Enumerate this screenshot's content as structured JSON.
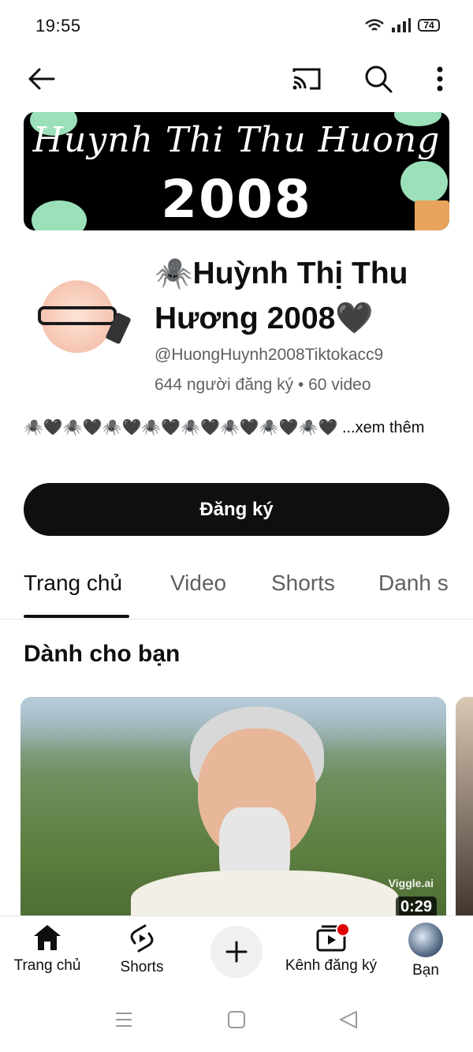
{
  "status_bar": {
    "time": "19:55",
    "battery": "74",
    "icons": [
      "wifi-icon",
      "signal-icon",
      "battery-icon"
    ]
  },
  "top_bar": {
    "icons": [
      "back-arrow-icon",
      "cast-icon",
      "search-icon",
      "more-vert-icon"
    ]
  },
  "banner": {
    "script_text": "Huynh Thi Thu Huong",
    "year": "2008"
  },
  "channel": {
    "name": "🕷️Huỳnh Thị Thu Hương 2008🖤",
    "handle": "@HuongHuynh2008Tiktokacc9",
    "stats": "644 người đăng ký • 60 video",
    "bio": "🕷️🖤🕷️🖤🕷️🖤🕷️🖤🕷️🖤🕷️🖤🕷️🖤🕷️🖤 ...xem thêm",
    "subscribe_label": "Đăng ký"
  },
  "tabs": [
    {
      "label": "Trang chủ",
      "active": true
    },
    {
      "label": "Video",
      "active": false
    },
    {
      "label": "Shorts",
      "active": false
    },
    {
      "label": "Danh s",
      "active": false
    }
  ],
  "section": {
    "title": "Dành cho bạn"
  },
  "video_card": {
    "duration": "0:29",
    "watermark": "Viggle.ai"
  },
  "bottom_nav": {
    "items": [
      {
        "label": "Trang chủ",
        "icon": "home-icon"
      },
      {
        "label": "Shorts",
        "icon": "shorts-icon"
      },
      {
        "label": "",
        "icon": "create-plus-icon"
      },
      {
        "label": "Kênh đăng ký",
        "icon": "subscriptions-icon"
      },
      {
        "label": "Bạn",
        "icon": "avatar-icon"
      }
    ]
  },
  "system_nav": {
    "icons": [
      "recents-icon",
      "home-square-icon",
      "back-triangle-icon"
    ]
  },
  "colors": {
    "text_primary": "#0f0f0f",
    "text_secondary": "#606060",
    "notification_dot": "#e00000"
  }
}
